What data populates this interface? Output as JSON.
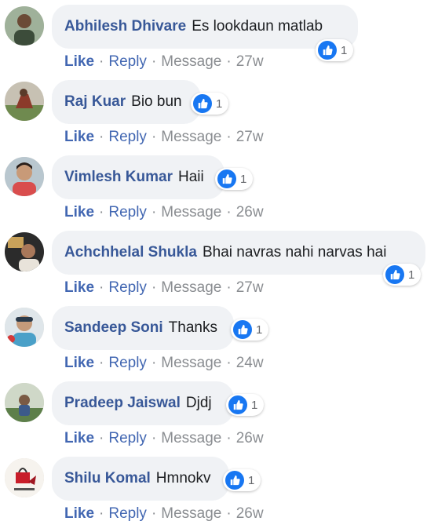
{
  "comments": [
    {
      "author": "Abhilesh Dhivare",
      "text": "Es lookdaun matlab",
      "likes": "1",
      "actions": {
        "like": "Like",
        "reply": "Reply",
        "message": "Message",
        "time": "27w"
      }
    },
    {
      "author": "Raj Kuar",
      "text": "Bio bun",
      "likes": "1",
      "actions": {
        "like": "Like",
        "reply": "Reply",
        "message": "Message",
        "time": "27w"
      }
    },
    {
      "author": "Vimlesh Kumar",
      "text": "Haii",
      "likes": "1",
      "actions": {
        "like": "Like",
        "reply": "Reply",
        "message": "Message",
        "time": "26w"
      }
    },
    {
      "author": "Achchhelal Shukla",
      "text": "Bhai navras nahi narvas hai",
      "likes": "1",
      "actions": {
        "like": "Like",
        "reply": "Reply",
        "message": "Message",
        "time": "27w"
      }
    },
    {
      "author": "Sandeep Soni",
      "text": "Thanks",
      "likes": "1",
      "actions": {
        "like": "Like",
        "reply": "Reply",
        "message": "Message",
        "time": "24w"
      }
    },
    {
      "author": "Pradeep Jaiswal",
      "text": "Djdj",
      "likes": "1",
      "actions": {
        "like": "Like",
        "reply": "Reply",
        "message": "Message",
        "time": "26w"
      }
    },
    {
      "author": "Shilu Komal",
      "text": "Hmnokv",
      "likes": "1",
      "actions": {
        "like": "Like",
        "reply": "Reply",
        "message": "Message",
        "time": "26w"
      }
    }
  ],
  "separator": "·",
  "colors": {
    "author": "#385898",
    "bubble": "#f0f2f5",
    "like_badge": "#1877f2",
    "meta": "#8a8d91",
    "link": "#4267b2"
  },
  "icons": {
    "reaction": "thumbs-up-icon",
    "avatar": "profile-photo"
  }
}
